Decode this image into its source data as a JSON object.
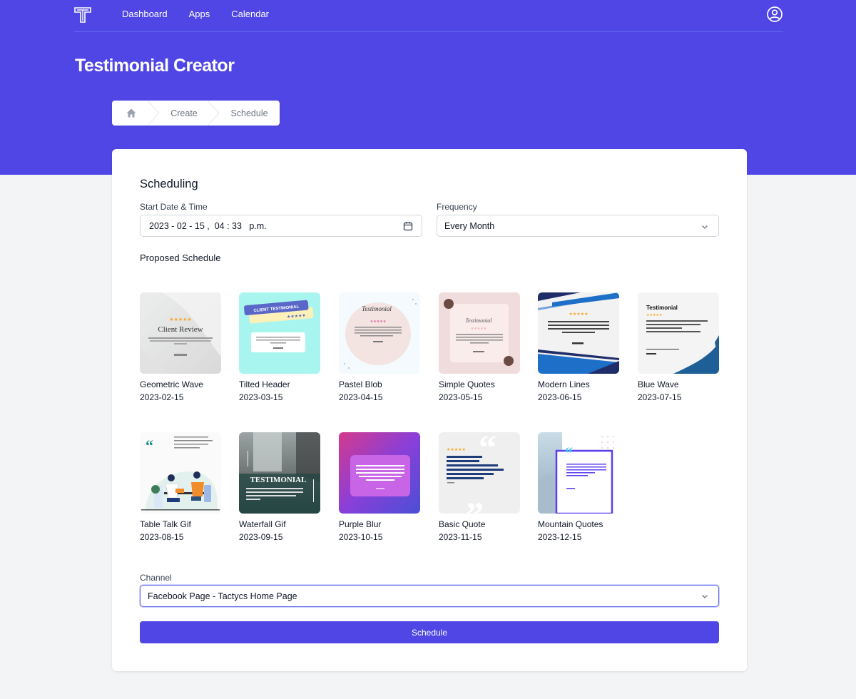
{
  "app": {
    "logo_letter": "T",
    "nav": [
      {
        "label": "Dashboard"
      },
      {
        "label": "Apps"
      },
      {
        "label": "Calendar"
      }
    ],
    "colors": {
      "brand": "#4f46e5",
      "background": "#f3f4f6",
      "card": "#ffffff"
    }
  },
  "page": {
    "title": "Testimonial Creator"
  },
  "breadcrumb": {
    "items": [
      {
        "label": "Home",
        "icon": "home-icon"
      },
      {
        "label": "Create"
      },
      {
        "label": "Schedule"
      }
    ]
  },
  "scheduling": {
    "title": "Scheduling",
    "start": {
      "label": "Start Date & Time",
      "value": "2023 - 02 - 15 ,  04 : 33   p.m."
    },
    "frequency": {
      "label": "Frequency",
      "value": "Every Month"
    },
    "proposed_title": "Proposed Schedule",
    "templates": [
      {
        "name": "Geometric Wave",
        "date": "2023-02-15",
        "thumb_text": "Client Review"
      },
      {
        "name": "Tilted Header",
        "date": "2023-03-15",
        "thumb_text": "CLIENT TESTIMONIAL"
      },
      {
        "name": "Pastel Blob",
        "date": "2023-04-15",
        "thumb_text": "Testimonial"
      },
      {
        "name": "Simple Quotes",
        "date": "2023-05-15",
        "thumb_text": "Testimonial"
      },
      {
        "name": "Modern Lines",
        "date": "2023-06-15",
        "thumb_text": "We can even schedule our testimonials so we never have to worry about sharing to social media!"
      },
      {
        "name": "Blue Wave",
        "date": "2023-07-15",
        "thumb_text": "Testimonial"
      },
      {
        "name": "Table Talk Gif",
        "date": "2023-08-15",
        "thumb_text": ""
      },
      {
        "name": "Waterfall Gif",
        "date": "2023-09-15",
        "thumb_text": "TESTIMONIAL"
      },
      {
        "name": "Purple Blur",
        "date": "2023-10-15",
        "thumb_text": "WE CAN EVEN SCHEDULE OUR TESTIMONIALS SO WE NEVER HAVE TO WORRY ABOUT SHARING TO SOCIAL MEDIA!"
      },
      {
        "name": "Basic Quote",
        "date": "2023-11-15",
        "thumb_text": "We can even schedule our testimonials so we never have to worry about sharing to social media!"
      },
      {
        "name": "Mountain Quotes",
        "date": "2023-12-15",
        "thumb_text": "We can even schedule our testimonials so we never have to worry about sharing to social media!"
      }
    ],
    "channel": {
      "label": "Channel",
      "value": "Facebook Page - Tactycs Home Page"
    },
    "submit_label": "Schedule"
  }
}
